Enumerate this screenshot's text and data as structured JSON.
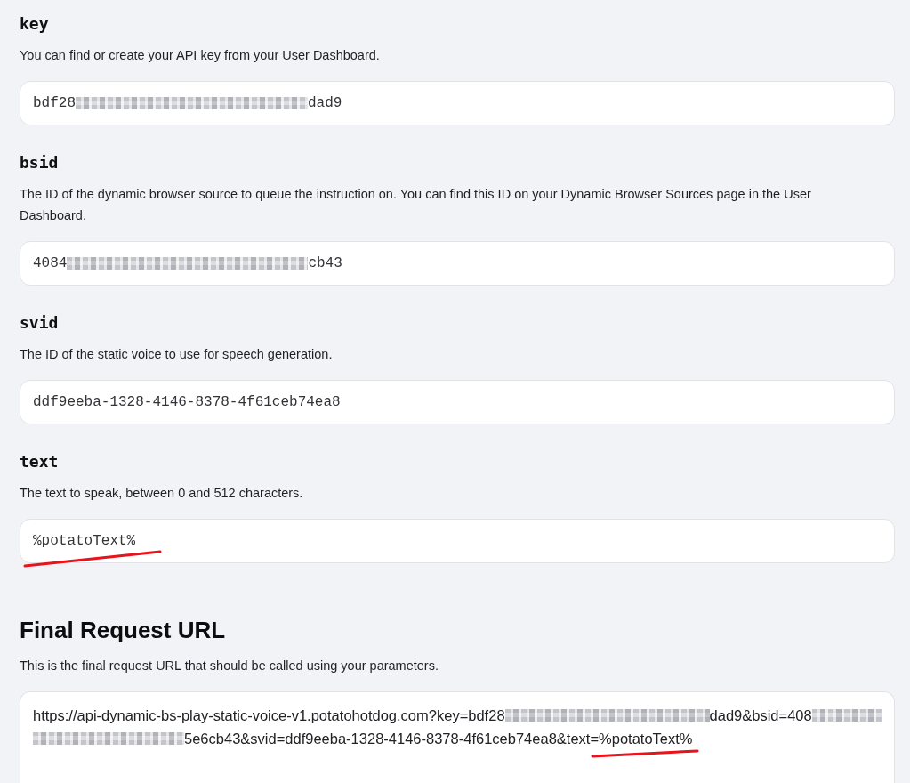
{
  "params": [
    {
      "name": "key",
      "description": "You can find or create your API key from your User Dashboard.",
      "value": [
        {
          "kind": "text",
          "text": "bdf28"
        },
        {
          "kind": "redacted"
        },
        {
          "kind": "text",
          "text": "dad9"
        }
      ],
      "annotated": false
    },
    {
      "name": "bsid",
      "description": "The ID of the dynamic browser source to queue the instruction on. You can find this ID on your Dynamic Browser Sources page in the User Dashboard.",
      "value": [
        {
          "kind": "text",
          "text": "4084"
        },
        {
          "kind": "redacted"
        },
        {
          "kind": "text",
          "text": "cb43"
        }
      ],
      "annotated": false
    },
    {
      "name": "svid",
      "description": "The ID of the static voice to use for speech generation.",
      "value": [
        {
          "kind": "text",
          "text": "ddf9eeba-1328-4146-8378-4f61ceb74ea8"
        }
      ],
      "annotated": false
    },
    {
      "name": "text",
      "description": "The text to speak, between 0 and 512 characters.",
      "value": [
        {
          "kind": "text",
          "text": "%potatoText%"
        }
      ],
      "annotated": true
    }
  ],
  "final_url": {
    "title": "Final Request URL",
    "description": "This is the final request URL that should be called using your parameters.",
    "lines": [
      [
        {
          "kind": "text",
          "text": "https://api-dynamic-bs-play-static-voice-v1.potatohotdog.com?key=bdf28",
          "annotated": false
        },
        {
          "kind": "redacted"
        },
        {
          "kind": "text",
          "text": "dad9&bsid=408",
          "annotated": false
        },
        {
          "kind": "redacted"
        }
      ],
      [
        {
          "kind": "redacted"
        },
        {
          "kind": "text",
          "text": "5e6cb43&svid=ddf9eeba-1328-4146-8378-4f61ceb74ea8&text=",
          "annotated": false
        },
        {
          "kind": "text",
          "text": "%potatoText%",
          "annotated": true
        }
      ]
    ]
  }
}
